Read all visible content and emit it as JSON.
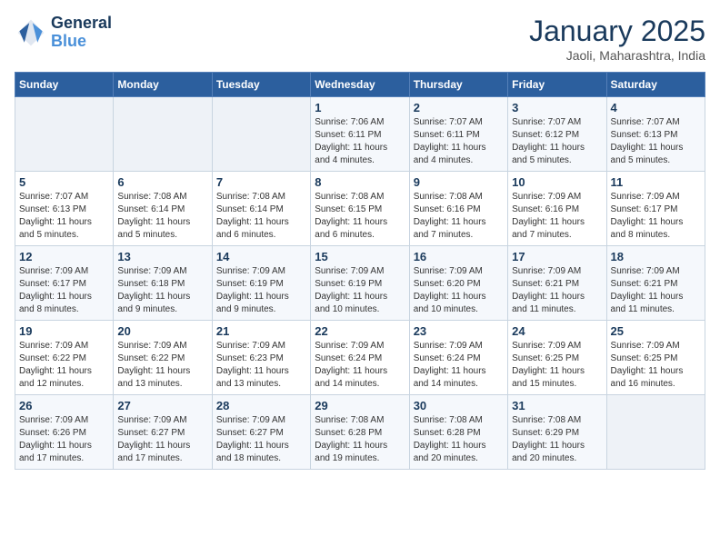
{
  "header": {
    "logo_line1": "General",
    "logo_line2": "Blue",
    "month": "January 2025",
    "location": "Jaoli, Maharashtra, India"
  },
  "weekdays": [
    "Sunday",
    "Monday",
    "Tuesday",
    "Wednesday",
    "Thursday",
    "Friday",
    "Saturday"
  ],
  "weeks": [
    [
      {
        "day": "",
        "info": ""
      },
      {
        "day": "",
        "info": ""
      },
      {
        "day": "",
        "info": ""
      },
      {
        "day": "1",
        "info": "Sunrise: 7:06 AM\nSunset: 6:11 PM\nDaylight: 11 hours\nand 4 minutes."
      },
      {
        "day": "2",
        "info": "Sunrise: 7:07 AM\nSunset: 6:11 PM\nDaylight: 11 hours\nand 4 minutes."
      },
      {
        "day": "3",
        "info": "Sunrise: 7:07 AM\nSunset: 6:12 PM\nDaylight: 11 hours\nand 5 minutes."
      },
      {
        "day": "4",
        "info": "Sunrise: 7:07 AM\nSunset: 6:13 PM\nDaylight: 11 hours\nand 5 minutes."
      }
    ],
    [
      {
        "day": "5",
        "info": "Sunrise: 7:07 AM\nSunset: 6:13 PM\nDaylight: 11 hours\nand 5 minutes."
      },
      {
        "day": "6",
        "info": "Sunrise: 7:08 AM\nSunset: 6:14 PM\nDaylight: 11 hours\nand 5 minutes."
      },
      {
        "day": "7",
        "info": "Sunrise: 7:08 AM\nSunset: 6:14 PM\nDaylight: 11 hours\nand 6 minutes."
      },
      {
        "day": "8",
        "info": "Sunrise: 7:08 AM\nSunset: 6:15 PM\nDaylight: 11 hours\nand 6 minutes."
      },
      {
        "day": "9",
        "info": "Sunrise: 7:08 AM\nSunset: 6:16 PM\nDaylight: 11 hours\nand 7 minutes."
      },
      {
        "day": "10",
        "info": "Sunrise: 7:09 AM\nSunset: 6:16 PM\nDaylight: 11 hours\nand 7 minutes."
      },
      {
        "day": "11",
        "info": "Sunrise: 7:09 AM\nSunset: 6:17 PM\nDaylight: 11 hours\nand 8 minutes."
      }
    ],
    [
      {
        "day": "12",
        "info": "Sunrise: 7:09 AM\nSunset: 6:17 PM\nDaylight: 11 hours\nand 8 minutes."
      },
      {
        "day": "13",
        "info": "Sunrise: 7:09 AM\nSunset: 6:18 PM\nDaylight: 11 hours\nand 9 minutes."
      },
      {
        "day": "14",
        "info": "Sunrise: 7:09 AM\nSunset: 6:19 PM\nDaylight: 11 hours\nand 9 minutes."
      },
      {
        "day": "15",
        "info": "Sunrise: 7:09 AM\nSunset: 6:19 PM\nDaylight: 11 hours\nand 10 minutes."
      },
      {
        "day": "16",
        "info": "Sunrise: 7:09 AM\nSunset: 6:20 PM\nDaylight: 11 hours\nand 10 minutes."
      },
      {
        "day": "17",
        "info": "Sunrise: 7:09 AM\nSunset: 6:21 PM\nDaylight: 11 hours\nand 11 minutes."
      },
      {
        "day": "18",
        "info": "Sunrise: 7:09 AM\nSunset: 6:21 PM\nDaylight: 11 hours\nand 11 minutes."
      }
    ],
    [
      {
        "day": "19",
        "info": "Sunrise: 7:09 AM\nSunset: 6:22 PM\nDaylight: 11 hours\nand 12 minutes."
      },
      {
        "day": "20",
        "info": "Sunrise: 7:09 AM\nSunset: 6:22 PM\nDaylight: 11 hours\nand 13 minutes."
      },
      {
        "day": "21",
        "info": "Sunrise: 7:09 AM\nSunset: 6:23 PM\nDaylight: 11 hours\nand 13 minutes."
      },
      {
        "day": "22",
        "info": "Sunrise: 7:09 AM\nSunset: 6:24 PM\nDaylight: 11 hours\nand 14 minutes."
      },
      {
        "day": "23",
        "info": "Sunrise: 7:09 AM\nSunset: 6:24 PM\nDaylight: 11 hours\nand 14 minutes."
      },
      {
        "day": "24",
        "info": "Sunrise: 7:09 AM\nSunset: 6:25 PM\nDaylight: 11 hours\nand 15 minutes."
      },
      {
        "day": "25",
        "info": "Sunrise: 7:09 AM\nSunset: 6:25 PM\nDaylight: 11 hours\nand 16 minutes."
      }
    ],
    [
      {
        "day": "26",
        "info": "Sunrise: 7:09 AM\nSunset: 6:26 PM\nDaylight: 11 hours\nand 17 minutes."
      },
      {
        "day": "27",
        "info": "Sunrise: 7:09 AM\nSunset: 6:27 PM\nDaylight: 11 hours\nand 17 minutes."
      },
      {
        "day": "28",
        "info": "Sunrise: 7:09 AM\nSunset: 6:27 PM\nDaylight: 11 hours\nand 18 minutes."
      },
      {
        "day": "29",
        "info": "Sunrise: 7:08 AM\nSunset: 6:28 PM\nDaylight: 11 hours\nand 19 minutes."
      },
      {
        "day": "30",
        "info": "Sunrise: 7:08 AM\nSunset: 6:28 PM\nDaylight: 11 hours\nand 20 minutes."
      },
      {
        "day": "31",
        "info": "Sunrise: 7:08 AM\nSunset: 6:29 PM\nDaylight: 11 hours\nand 20 minutes."
      },
      {
        "day": "",
        "info": ""
      }
    ]
  ]
}
